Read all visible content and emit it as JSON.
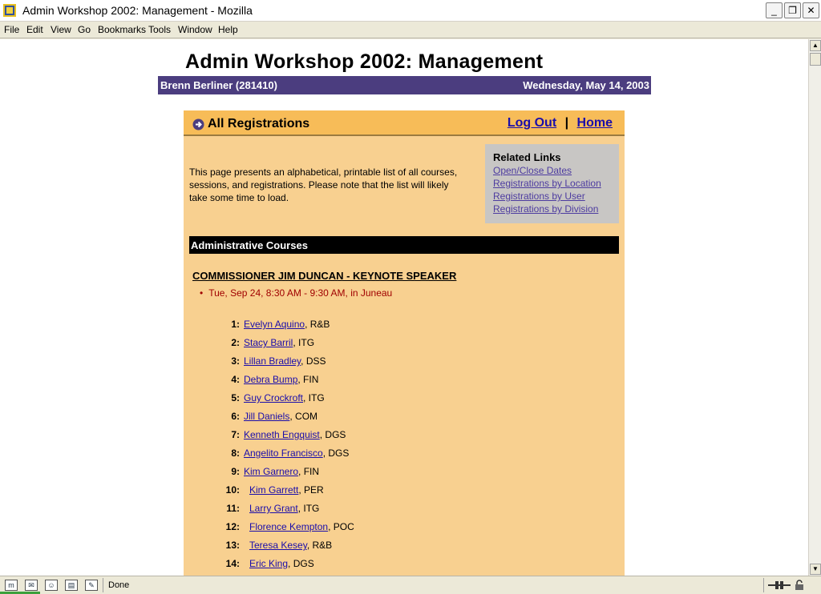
{
  "window": {
    "title": "Admin Workshop 2002: Management - Mozilla",
    "min": "_",
    "max": "❐",
    "close": "✕"
  },
  "menu": [
    {
      "label": "File"
    },
    {
      "label": "Edit"
    },
    {
      "label": "View"
    },
    {
      "label": "Go"
    },
    {
      "label": "Bookmarks"
    },
    {
      "label": "Tools"
    },
    {
      "label": "Window"
    },
    {
      "label": "Help"
    }
  ],
  "page": {
    "title": "Admin Workshop 2002: Management",
    "user": "Brenn Berliner (281410)",
    "date": "Wednesday, May 14, 2003"
  },
  "panel": {
    "heading": "All Registrations",
    "logout": "Log Out",
    "separator": "|",
    "home": "Home",
    "intro": "This page presents an alphabetical, printable list of all courses, sessions, and registrations. Please note that the list will likely take some time to load."
  },
  "related": {
    "heading": "Related Links",
    "links": [
      "Open/Close Dates",
      "Registrations by Location",
      "Registrations by User",
      "Registrations by Division"
    ]
  },
  "section": "Administrative Courses",
  "course": {
    "title": "COMMISSIONER JIM DUNCAN - KEYNOTE SPEAKER",
    "session": "Tue, Sep 24, 8:30 AM - 9:30 AM, in Juneau",
    "bullet": "•"
  },
  "registrations": [
    {
      "num": "1:",
      "name": "Evelyn Aquino",
      "dept": ", R&B"
    },
    {
      "num": "2:",
      "name": "Stacy Barril",
      "dept": ", ITG"
    },
    {
      "num": "3:",
      "name": "Lillan Bradley",
      "dept": ", DSS"
    },
    {
      "num": "4:",
      "name": "Debra Bump",
      "dept": ", FIN"
    },
    {
      "num": "5:",
      "name": "Guy Crockroft",
      "dept": ", ITG"
    },
    {
      "num": "6:",
      "name": "Jill Daniels",
      "dept": ", COM"
    },
    {
      "num": "7:",
      "name": "Kenneth Engquist",
      "dept": ", DGS"
    },
    {
      "num": "8:",
      "name": "Angelito Francisco",
      "dept": ", DGS"
    },
    {
      "num": "9:",
      "name": "Kim Garnero",
      "dept": ", FIN"
    },
    {
      "num": "10:",
      "name": "Kim Garrett",
      "dept": ", PER"
    },
    {
      "num": "11:",
      "name": "Larry Grant",
      "dept": ", ITG"
    },
    {
      "num": "12:",
      "name": "Florence Kempton",
      "dept": ", POC"
    },
    {
      "num": "13:",
      "name": "Teresa Kesey",
      "dept": ", R&B"
    },
    {
      "num": "14:",
      "name": "Eric King",
      "dept": ", DGS"
    }
  ],
  "status": {
    "text": "Done"
  },
  "colors": {
    "userbar": "#4b3d7f",
    "panel": "#f8d090",
    "panel_header": "#f7bc58",
    "link": "#1a0dab",
    "session": "#a00000"
  }
}
